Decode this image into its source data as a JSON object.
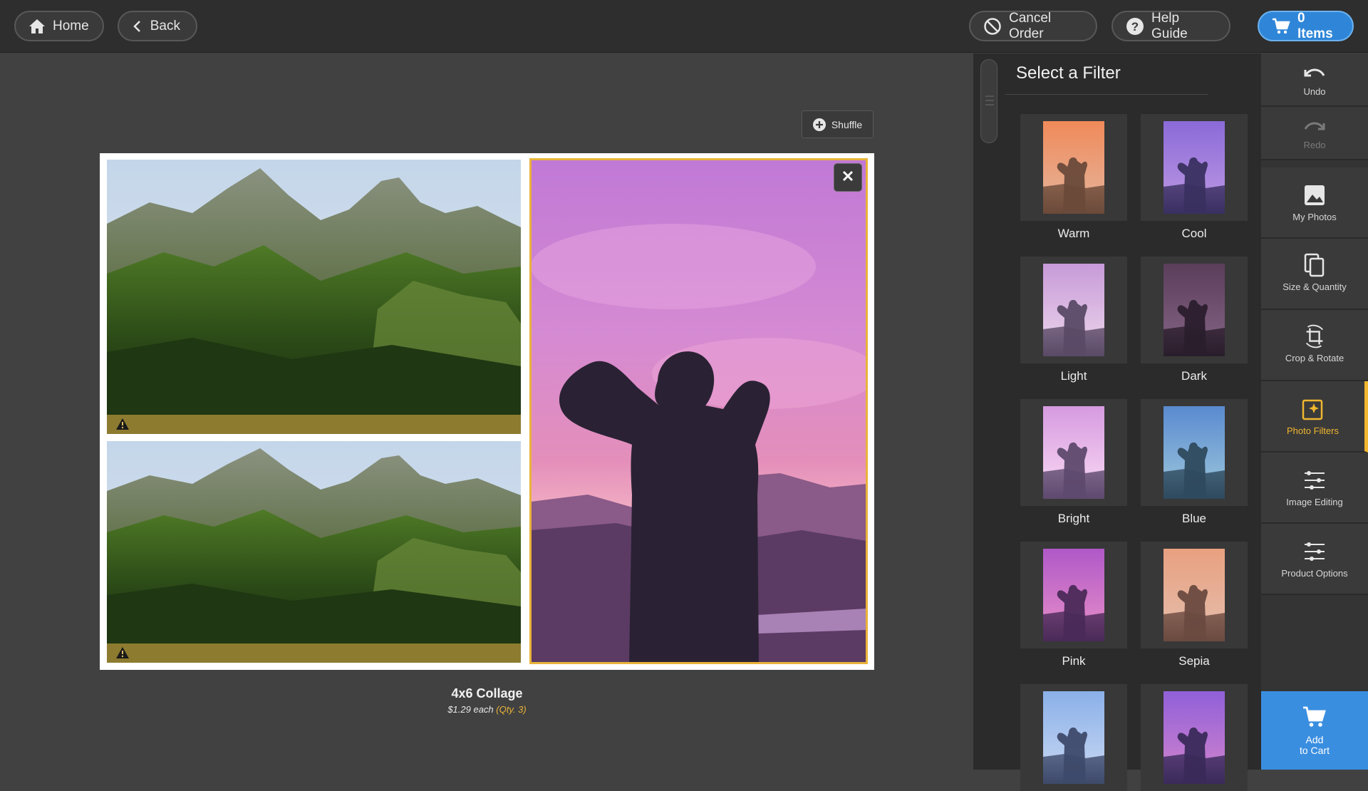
{
  "topbar": {
    "home_label": "Home",
    "back_label": "Back",
    "cancel_label": "Cancel Order",
    "help_label": "Help Guide",
    "cart_label": "0 Items"
  },
  "canvas": {
    "shuffle_label": "Shuffle",
    "product_title": "4x6 Collage",
    "product_price": "$1.29 each",
    "product_qty": "(Qty. 3)"
  },
  "filters": {
    "title": "Select a Filter",
    "items": [
      {
        "label": "Warm"
      },
      {
        "label": "Cool"
      },
      {
        "label": "Light"
      },
      {
        "label": "Dark"
      },
      {
        "label": "Bright"
      },
      {
        "label": "Blue"
      },
      {
        "label": "Pink"
      },
      {
        "label": "Sepia"
      },
      {
        "label": ""
      },
      {
        "label": ""
      }
    ]
  },
  "tools": {
    "undo": "Undo",
    "redo": "Redo",
    "my_photos": "My Photos",
    "size_quantity": "Size & Quantity",
    "crop_rotate": "Crop & Rotate",
    "photo_filters": "Photo Filters",
    "image_editing": "Image Editing",
    "product_options": "Product Options",
    "add_to_cart_1": "Add",
    "add_to_cart_2": "to Cart"
  },
  "colors": {
    "accent": "#f0b62f",
    "cart_blue": "#2f86d8",
    "add_cart_blue": "#3a8ee0"
  }
}
